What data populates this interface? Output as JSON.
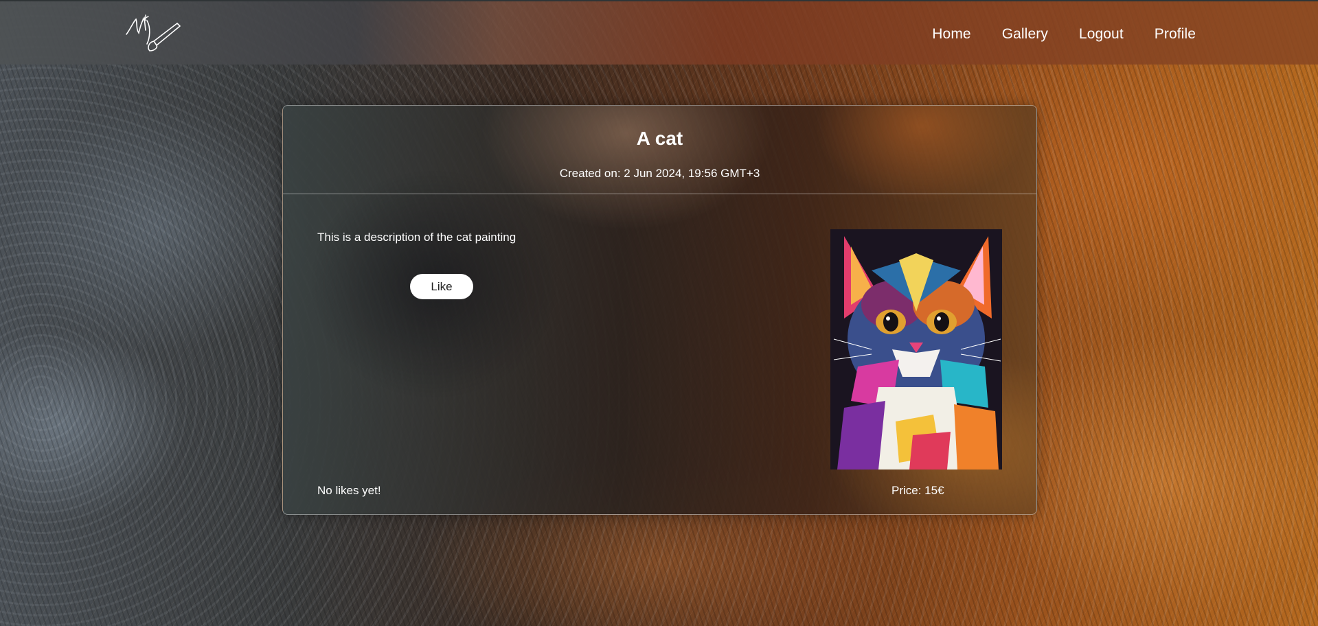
{
  "nav": {
    "links": [
      "Home",
      "Gallery",
      "Logout",
      "Profile"
    ]
  },
  "artwork": {
    "title": "A cat",
    "created": "Created on: 2 Jun 2024, 19:56 GMT+3",
    "description": "This is a description of the cat painting",
    "like_label": "Like",
    "likes_text": "No likes yet!",
    "price_text": "Price: 15€"
  },
  "colors": {
    "button_bg": "#ffffff",
    "text": "#ffffff"
  }
}
